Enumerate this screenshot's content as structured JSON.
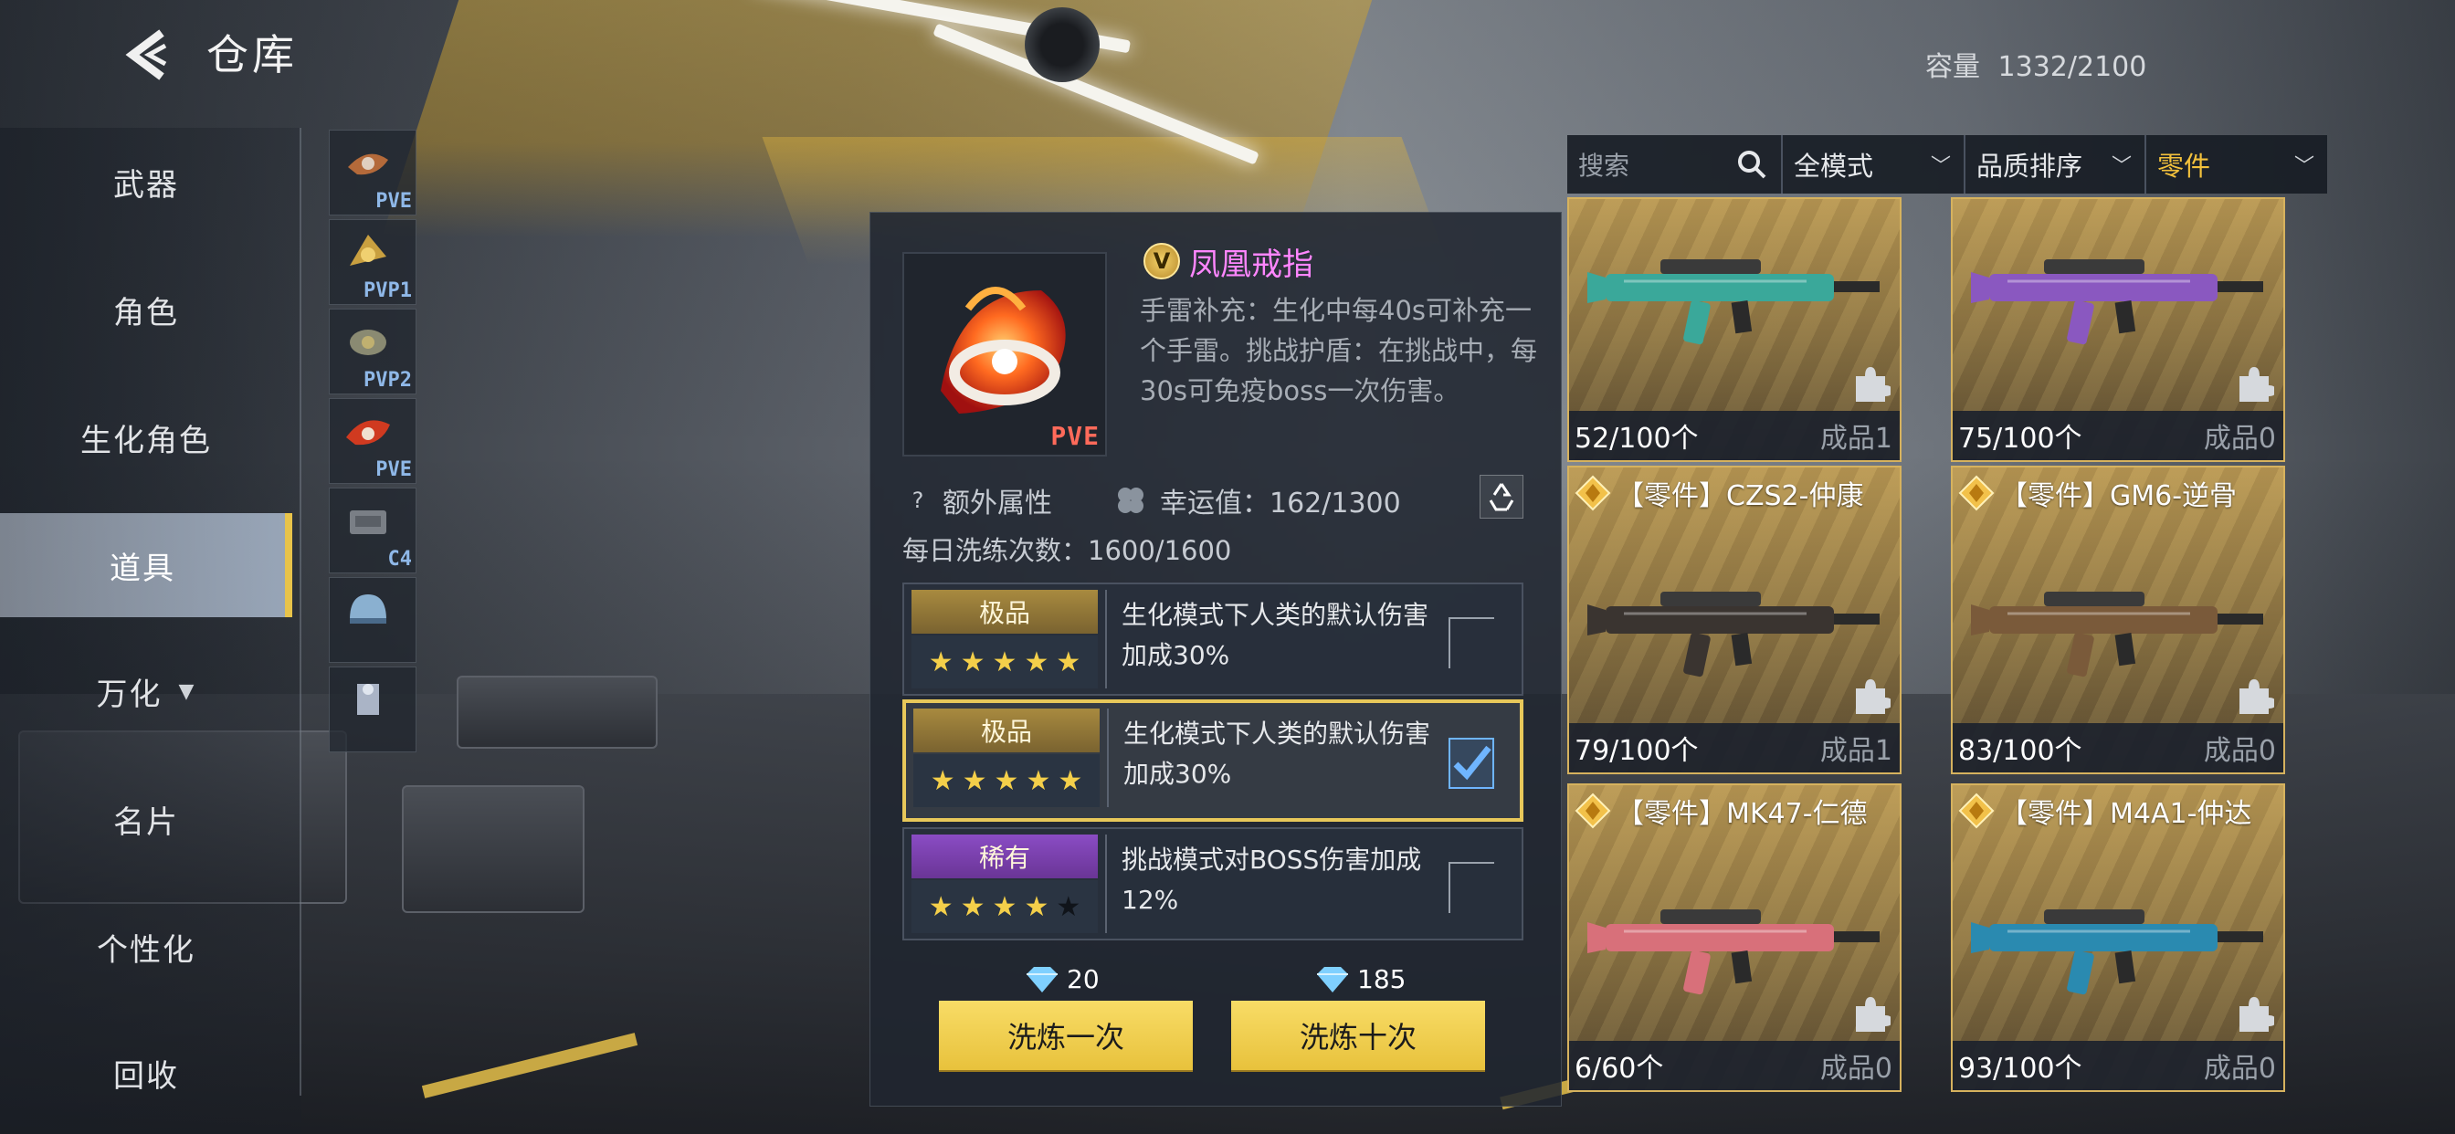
{
  "header": {
    "title": "仓库",
    "capacity_label": "容量",
    "capacity_value": "1332/2100"
  },
  "nav": {
    "items": [
      {
        "label": "武器"
      },
      {
        "label": "角色"
      },
      {
        "label": "生化角色"
      },
      {
        "label": "道具",
        "active": true
      },
      {
        "label": "万化"
      },
      {
        "label": "名片"
      },
      {
        "label": "个性化"
      },
      {
        "label": "回收"
      }
    ]
  },
  "thumbs": [
    {
      "label": "PVE"
    },
    {
      "label": "PVP1"
    },
    {
      "label": "PVP2"
    },
    {
      "label": "PVE"
    },
    {
      "label": "C4"
    },
    {
      "label": ""
    },
    {
      "label": ""
    }
  ],
  "detail": {
    "name": "凤凰戒指",
    "icon_tag": "PVE",
    "badge": "V",
    "description": "手雷补充：生化中每40s可补充一个手雷。挑战护盾：在挑战中，每30s可免疫boss一次伤害。",
    "extra_attr_label": "额外属性",
    "luck_label": "幸运值：162/1300",
    "daily_label": "每日洗练次数：1600/1600",
    "attributes": [
      {
        "grade": "极品",
        "grade_color": "gold",
        "stars": 5,
        "max_stars": 5,
        "text": "生化模式下人类的默认伤害加成30%",
        "checked": false
      },
      {
        "grade": "极品",
        "grade_color": "gold",
        "stars": 5,
        "max_stars": 5,
        "text": "生化模式下人类的默认伤害加成30%",
        "checked": true
      },
      {
        "grade": "稀有",
        "grade_color": "purple",
        "stars": 4,
        "max_stars": 5,
        "text": "挑战模式对BOSS伤害加成12%",
        "checked": false
      }
    ],
    "cost_once": "20",
    "cost_ten": "185",
    "btn_once": "洗炼一次",
    "btn_ten": "洗炼十次"
  },
  "filters": {
    "search_placeholder": "搜索",
    "mode": "全模式",
    "sort": "品质排序",
    "category": "零件"
  },
  "grid": [
    {
      "title": "",
      "count": "52/100个",
      "made": "成品1",
      "gun_color": "#3aa89a"
    },
    {
      "title": "",
      "count": "75/100个",
      "made": "成品0",
      "gun_color": "#8a58c0"
    },
    {
      "title": "【零件】CZS2-仲康",
      "count": "79/100个",
      "made": "成品1",
      "gun_color": "#3a3430"
    },
    {
      "title": "【零件】GM6-逆骨",
      "count": "83/100个",
      "made": "成品0",
      "gun_color": "#7a5a3a"
    },
    {
      "title": "【零件】MK47-仁德",
      "count": "6/60个",
      "made": "成品0",
      "gun_color": "#d8707a"
    },
    {
      "title": "【零件】M4A1-仲达",
      "count": "93/100个",
      "made": "成品0",
      "gun_color": "#2a8ab0"
    }
  ],
  "colors": {
    "accent_gold": "#e8c23c",
    "pink_name": "#ff86ff",
    "check_blue": "#6fb5ff"
  }
}
